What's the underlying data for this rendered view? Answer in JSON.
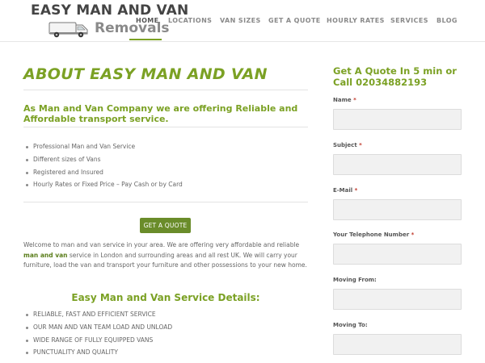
{
  "logo": {
    "title": "EASY MAN AND VAN",
    "subtitle": "Removals"
  },
  "nav": {
    "items": [
      {
        "label": "HOME",
        "active": true
      },
      {
        "label": "LOCATIONS",
        "active": false
      },
      {
        "label": "VAN SIZES",
        "active": false
      },
      {
        "label": "GET A QUOTE",
        "active": false
      },
      {
        "label": "HOURLY RATES",
        "active": false
      },
      {
        "label": "SERVICES",
        "active": false
      },
      {
        "label": "BLOG",
        "active": false
      }
    ]
  },
  "main": {
    "title": "ABOUT EASY MAN AND VAN",
    "subtitle": "As Man and Van Company we are offering Reliable and Affordable transport service.",
    "bullets": [
      "Professional Man and Van Service",
      "Different sizes of Vans",
      "Registered and Insured",
      "Hourly Rates or Fixed Price – Pay Cash or by Card"
    ],
    "cta_label": "GET A QUOTE",
    "intro": {
      "before": "Welcome to man and van service in your area. We are offering very affordable and reliable ",
      "highlight": "man and van",
      "after": " service in London and surrounding areas and all rest UK. We will carry your furniture, load the van and transport your furniture and other possessions to your new home."
    },
    "details_title": "Easy Man and Van Service Details:",
    "details": [
      "RELIABLE, FAST AND EFFICIENT SERVICE",
      "OUR MAN AND VAN TEAM LOAD AND UNLOAD",
      "WIDE RANGE OF FULLY EQUIPPED VANS",
      "PUNCTUALITY AND QUALITY"
    ]
  },
  "form": {
    "title": "Get A Quote In 5 min or Call 02034882193",
    "required_mark": "*",
    "fields": [
      {
        "label": "Name",
        "required": true,
        "value": "",
        "placeholder": ""
      },
      {
        "label": "Subject",
        "required": true,
        "value": "",
        "placeholder": ""
      },
      {
        "label": "E-Mail",
        "required": true,
        "value": "",
        "placeholder": ""
      },
      {
        "label": "Your Telephone Number",
        "required": true,
        "value": "",
        "placeholder": ""
      },
      {
        "label": "Moving From:",
        "required": false,
        "value": "",
        "placeholder": ""
      },
      {
        "label": "Moving To:",
        "required": false,
        "value": "",
        "placeholder": ""
      }
    ]
  },
  "colors": {
    "accent": "#7ba124",
    "button": "#6a8c2a",
    "required": "#c0392b",
    "input_bg": "#f1f1f1"
  },
  "icons": {
    "logo": "van-icon"
  }
}
